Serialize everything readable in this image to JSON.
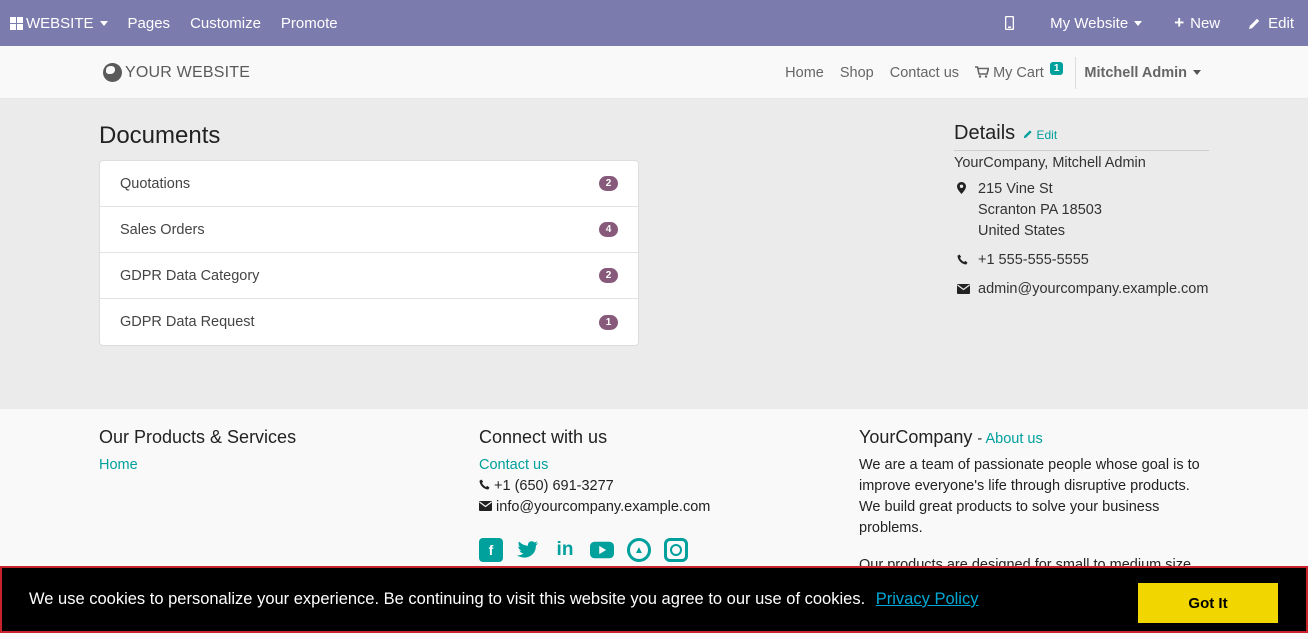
{
  "adminbar": {
    "website_menu": "WEBSITE",
    "pages": "Pages",
    "customize": "Customize",
    "promote": "Promote",
    "my_website": "My Website",
    "new": "New",
    "edit": "Edit"
  },
  "header": {
    "logo_text": "YOUR WEBSITE",
    "nav": [
      "Home",
      "Shop",
      "Contact us"
    ],
    "cart_label": "My Cart",
    "cart_count": "1",
    "user": "Mitchell Admin"
  },
  "documents": {
    "title": "Documents",
    "items": [
      {
        "label": "Quotations",
        "count": "2"
      },
      {
        "label": "Sales Orders",
        "count": "4"
      },
      {
        "label": "GDPR Data Category",
        "count": "2"
      },
      {
        "label": "GDPR Data Request",
        "count": "1"
      }
    ]
  },
  "details": {
    "title": "Details",
    "edit": "Edit",
    "company": "YourCompany, Mitchell Admin",
    "address": [
      "215 Vine St",
      "Scranton PA 18503",
      "United States"
    ],
    "phone": "+1 555-555-5555",
    "email": "admin@yourcompany.example.com"
  },
  "footer": {
    "products_title": "Our Products & Services",
    "products_link": "Home",
    "connect_title": "Connect with us",
    "contact_link": "Contact us",
    "phone": "+1 (650) 691-3277",
    "email": "info@yourcompany.example.com",
    "social_icons": [
      "facebook-icon",
      "twitter-icon",
      "linkedin-icon",
      "youtube-icon",
      "github-icon",
      "instagram-icon"
    ],
    "company_title": "YourCompany",
    "about_link": "About us",
    "about_p1": "We are a team of passionate people whose goal is to improve everyone's life through disruptive products. We build great products to solve your business problems.",
    "about_p2": "Our products are designed for small to medium size companies willing to optimize their performance."
  },
  "cookie": {
    "message": "We use cookies to personalize your experience. Be continuing to visit this website you agree to our use of cookies.",
    "policy_link": "Privacy Policy",
    "accept": "Got It"
  },
  "colors": {
    "adminbar": "#7c7bad",
    "accent": "#00a09d",
    "badge": "#875a7b",
    "cookie_button": "#f1d600"
  }
}
